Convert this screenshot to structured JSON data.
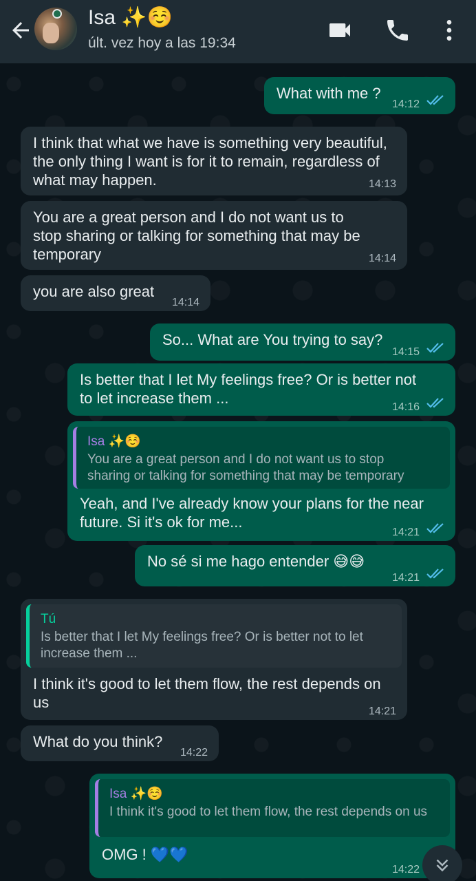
{
  "header": {
    "contact_name": "Isa ✨☺️",
    "status": "últ. vez hoy a las 19:34"
  },
  "icons": {
    "back": "back-arrow-icon",
    "video": "video-call-icon",
    "call": "phone-icon",
    "menu": "more-vert-icon",
    "scroll": "scroll-down-icon"
  },
  "colors": {
    "header_bg": "#1f2c34",
    "chat_bg": "#0b141a",
    "incoming_bubble": "#202c33",
    "outgoing_bubble": "#005c4b",
    "read_tick": "#53bdeb",
    "quote_purple": "#a57ee3",
    "quote_green": "#06cf9c"
  },
  "messages": [
    {
      "dir": "out",
      "text": "What with me ?",
      "time": "14:12"
    },
    {
      "dir": "in",
      "text": "I think that what we have is something very beautiful,\nthe only thing I want is for it to remain, regardless of\nwhat may happen.",
      "time": "14:13"
    },
    {
      "dir": "in",
      "text": "You are a great person and I do not want us to\nstop sharing or talking for something that may be\ntemporary",
      "time": "14:14"
    },
    {
      "dir": "in",
      "text": "you are also great",
      "time": "14:14"
    },
    {
      "dir": "out",
      "text": "So... What are You trying to say?",
      "time": "14:15"
    },
    {
      "dir": "out",
      "text": "Is better that I let My feelings free? Or is better not\nto let increase them ...",
      "time": "14:16"
    },
    {
      "dir": "out",
      "quote_name": "Isa ✨☺️",
      "quote_text": "You are a great person and I do not want us to stop\nsharing or talking for something that may be temporary",
      "text": "Yeah, and I've already know your plans for the near\nfuture. Si it's ok for me...",
      "time": "14:21"
    },
    {
      "dir": "out",
      "text": "No sé si me hago entender 😅😅",
      "time": "14:21"
    },
    {
      "dir": "in",
      "quote_name": "Tú",
      "quote_text": "Is better that I let My feelings free? Or is better not to let\nincrease them ...",
      "text": "I think it's good to let them flow, the rest depends on\nus",
      "time": "14:21"
    },
    {
      "dir": "in",
      "text": "What do you think?",
      "time": "14:22"
    },
    {
      "dir": "out",
      "quote_name": "Isa ✨☺️",
      "quote_text": "I think it's good to let them flow, the rest depends on us",
      "text": "OMG ! 💙💙",
      "time": "14:22"
    }
  ]
}
